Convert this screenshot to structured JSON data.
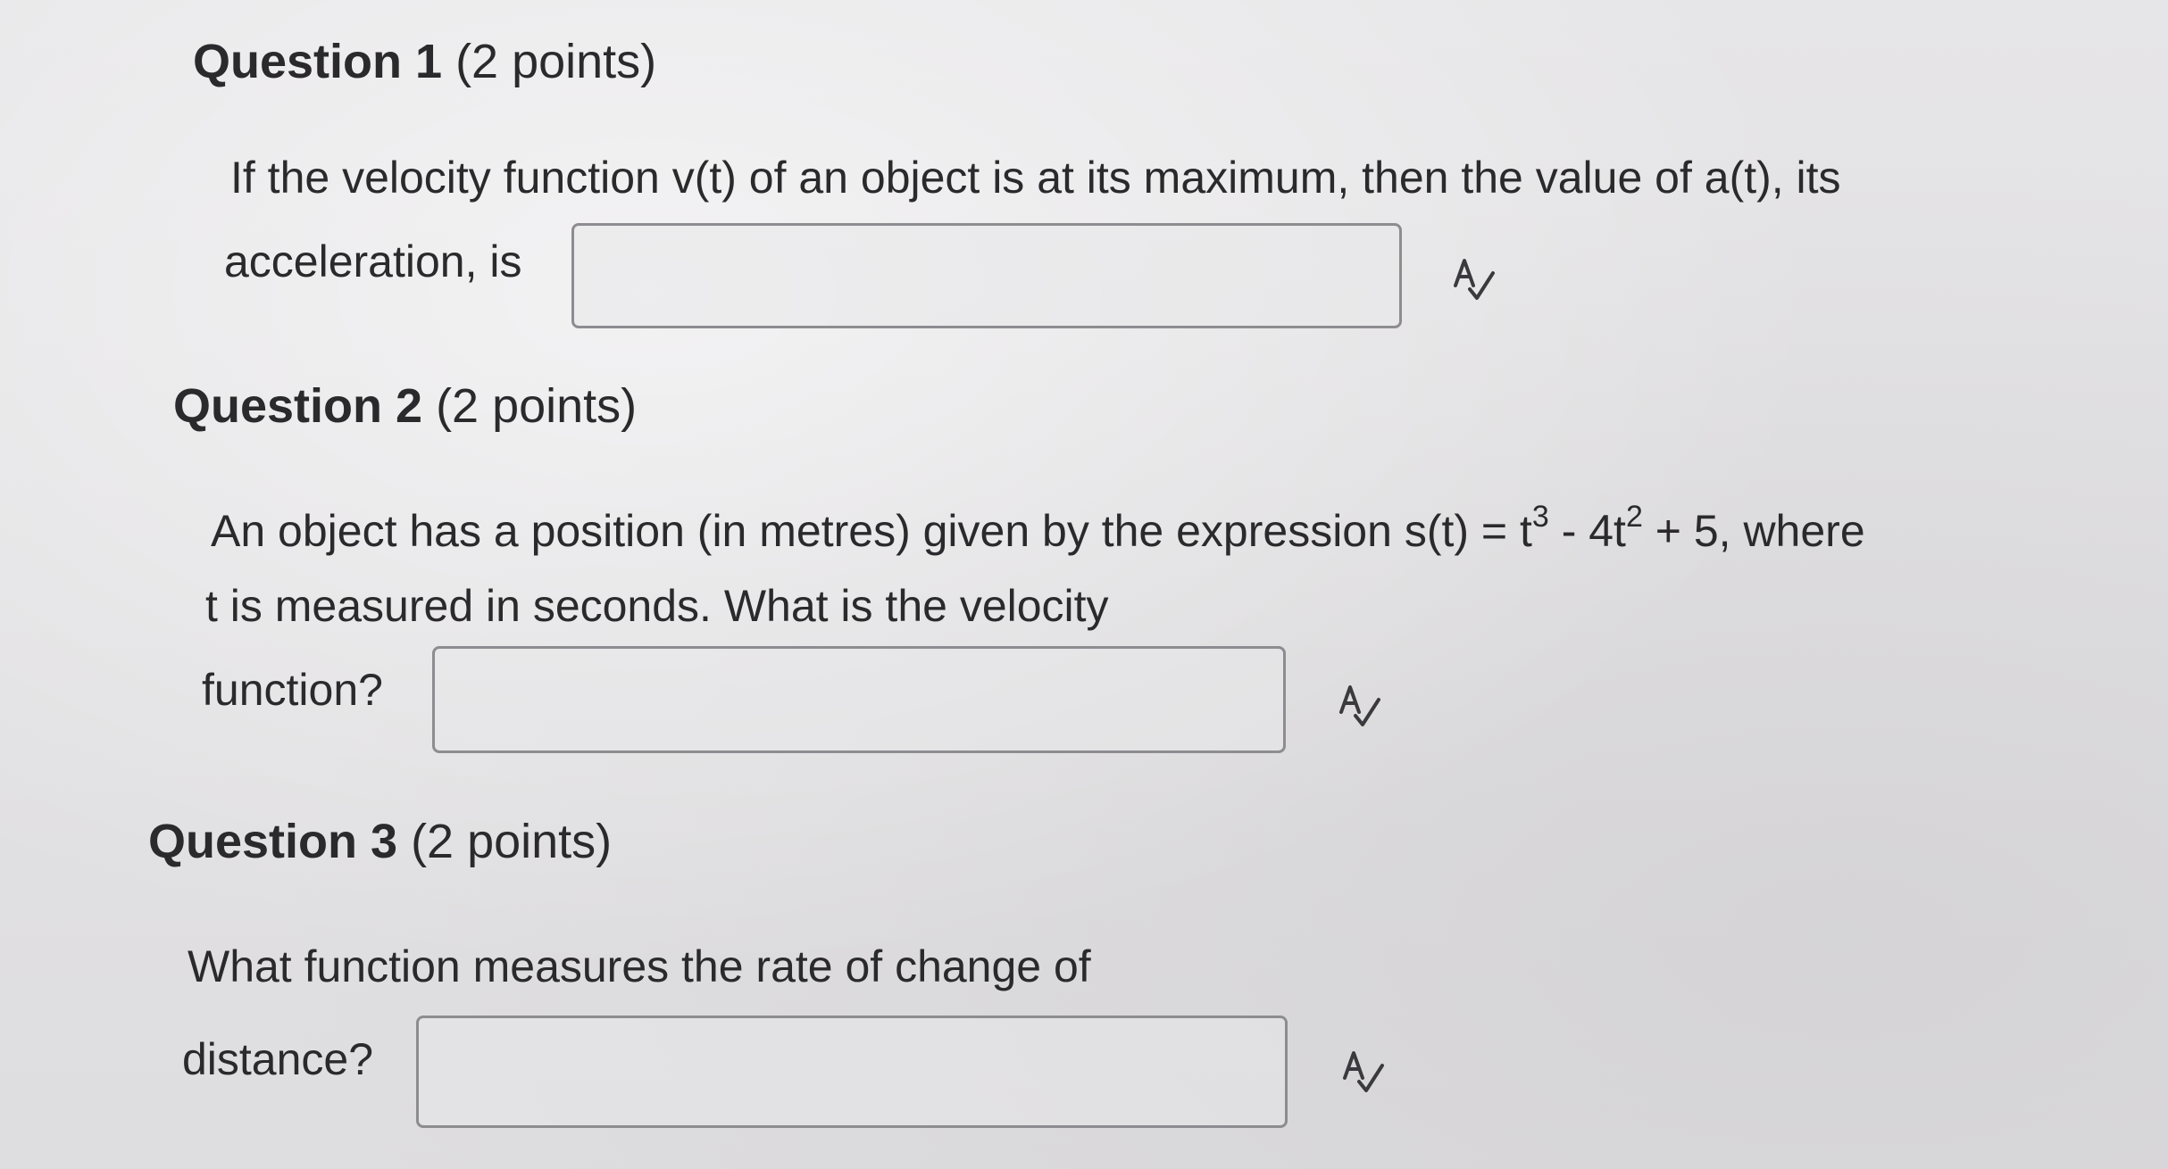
{
  "questions": [
    {
      "number_label": "Question 1",
      "points_label": "(2 points)",
      "line1": "If the velocity function v(t) of an object is at its maximum, then the value of a(t), its",
      "line2": "acceleration, is",
      "answer_value": "",
      "spellcheck_icon": "spellcheck-icon"
    },
    {
      "number_label": "Question 2",
      "points_label": "(2 points)",
      "line1_pre": "An object has a position (in metres) given by the expression s(t) = t",
      "line1_exp1": "3",
      "line1_mid": " - 4t",
      "line1_exp2": "2",
      "line1_post": " + 5, where",
      "line2": "t is measured in seconds.  What is the velocity",
      "line3": "function?",
      "answer_value": "",
      "spellcheck_icon": "spellcheck-icon"
    },
    {
      "number_label": "Question 3",
      "points_label": "(2 points)",
      "line1": "What function measures the rate of change of",
      "line2": "distance?",
      "answer_value": "",
      "spellcheck_icon": "spellcheck-icon"
    }
  ]
}
